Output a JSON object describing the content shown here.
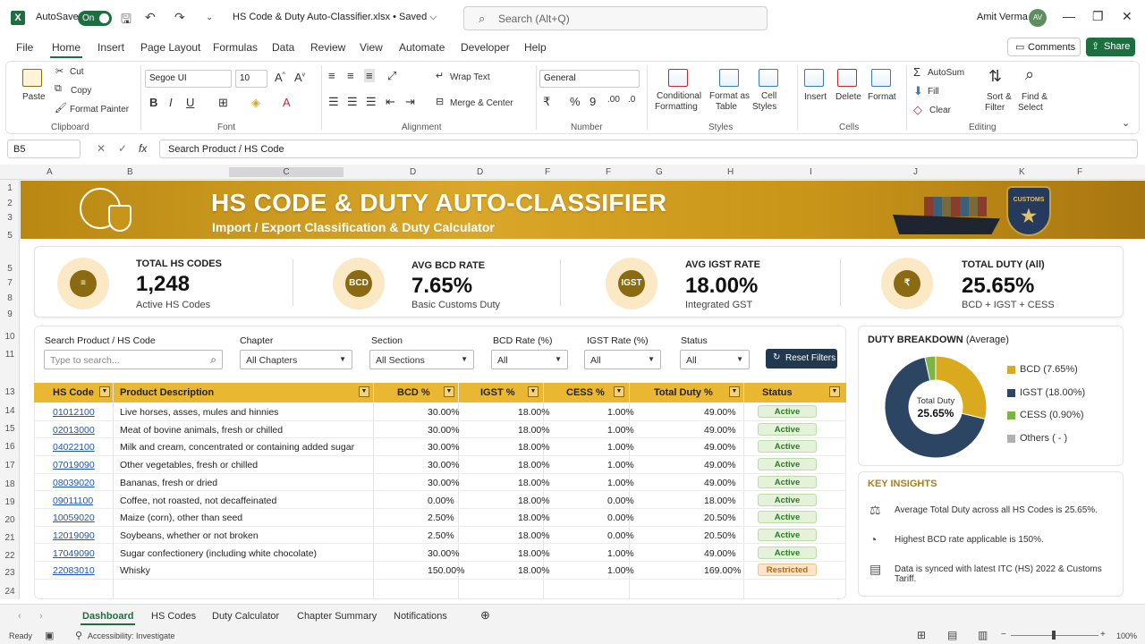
{
  "titlebar": {
    "autosave_label": "AutoSave",
    "toggle_label": "On",
    "filename": "HS Code & Duty Auto-Classifier.xlsx • Saved ⌵",
    "search_placeholder": "Search (Alt+Q)",
    "username": "Amit Verma",
    "avatar_initials": "AV"
  },
  "menu": {
    "tabs": [
      "File",
      "Home",
      "Insert",
      "Page Layout",
      "Formulas",
      "Data",
      "Review",
      "View",
      "Automate",
      "Developer",
      "Help"
    ],
    "comments": "Comments",
    "share": "Share"
  },
  "ribbon": {
    "clipboard": {
      "paste": "Paste",
      "cut": "Cut",
      "copy": "Copy",
      "format_painter": "Format Painter",
      "group": "Clipboard"
    },
    "font": {
      "name": "Segoe UI",
      "size": "10",
      "group": "Font"
    },
    "alignment": {
      "wrap": "Wrap Text",
      "merge": "Merge & Center",
      "group": "Alignment"
    },
    "number": {
      "format": "General",
      "group": "Number"
    },
    "styles": {
      "cond": "Conditional",
      "cond2": "Formatting",
      "fmt_table": "Format as",
      "fmt_table2": "Table",
      "cell_styles": "Cell",
      "cell_styles2": "Styles",
      "group": "Styles"
    },
    "cells": {
      "insert": "Insert",
      "delete": "Delete",
      "format": "Format",
      "group": "Cells"
    },
    "editing": {
      "autosum": "AutoSum",
      "fill": "Fill",
      "clear": "Clear",
      "sort": "Sort &",
      "sort2": "Filter",
      "find": "Find &",
      "find2": "Select",
      "group": "Editing"
    }
  },
  "formula_bar": {
    "name_box": "B5",
    "fx": "fx",
    "formula": "Search Product / HS Code"
  },
  "columns": [
    "A",
    "B",
    "C",
    "D",
    "D",
    "F",
    "F",
    "G",
    "H",
    "I",
    "J",
    "K",
    "F"
  ],
  "rows": [
    "1",
    "2",
    "3",
    "5",
    "5",
    "7",
    "8",
    "9",
    "10",
    "11",
    "13",
    "14",
    "15",
    "16",
    "17",
    "18",
    "19",
    "20",
    "21",
    "22",
    "23",
    "24"
  ],
  "banner": {
    "title": "HS CODE & DUTY AUTO-CLASSIFIER",
    "subtitle": "Import / Export Classification & Duty Calculator",
    "badge": "CUSTOMS"
  },
  "kpis": [
    {
      "label": "TOTAL HS CODES",
      "value": "1,248",
      "sub": "Active HS Codes",
      "icon": "stack-icon",
      "icon_text": "≡"
    },
    {
      "label": "AVG BCD RATE",
      "value": "7.65%",
      "sub": "Basic Customs Duty",
      "icon": "bcd-icon",
      "icon_text": "BCD"
    },
    {
      "label": "AVG IGST RATE",
      "value": "18.00%",
      "sub": "Integrated GST",
      "icon": "igst-icon",
      "icon_text": "IGST"
    },
    {
      "label": "TOTAL DUTY (All)",
      "value": "25.65%",
      "sub": "BCD + IGST + CESS",
      "icon": "piggy-bank-icon",
      "icon_text": "₹"
    }
  ],
  "filters": {
    "search": {
      "label": "Search Product / HS Code",
      "placeholder": "Type to search..."
    },
    "chapter": {
      "label": "Chapter",
      "value": "All Chapters"
    },
    "section": {
      "label": "Section",
      "value": "All Sections"
    },
    "bcd": {
      "label": "BCD Rate (%)",
      "value": "All"
    },
    "igst": {
      "label": "IGST Rate (%)",
      "value": "All"
    },
    "status": {
      "label": "Status",
      "value": "All"
    },
    "reset": "Reset Filters"
  },
  "table": {
    "headers": [
      "HS Code",
      "Product Description",
      "BCD %",
      "IGST %",
      "CESS %",
      "Total Duty %",
      "Status"
    ],
    "rows": [
      [
        "01012100",
        "Live horses, asses, mules and hinnies",
        "30.00%",
        "18.00%",
        "1.00%",
        "49.00%",
        "Active"
      ],
      [
        "02013000",
        "Meat of bovine animals, fresh or chilled",
        "30.00%",
        "18.00%",
        "1.00%",
        "49.00%",
        "Active"
      ],
      [
        "04022100",
        "Milk and cream, concentrated or containing added sugar",
        "30.00%",
        "18.00%",
        "1.00%",
        "49.00%",
        "Active"
      ],
      [
        "07019090",
        "Other vegetables, fresh or chilled",
        "30.00%",
        "18.00%",
        "1.00%",
        "49.00%",
        "Active"
      ],
      [
        "08039020",
        "Bananas, fresh or dried",
        "30.00%",
        "18.00%",
        "1.00%",
        "49.00%",
        "Active"
      ],
      [
        "09011100",
        "Coffee, not roasted, not decaffeinated",
        "0.00%",
        "18.00%",
        "0.00%",
        "18.00%",
        "Active"
      ],
      [
        "10059020",
        "Maize (corn), other than seed",
        "2.50%",
        "18.00%",
        "0.00%",
        "20.50%",
        "Active"
      ],
      [
        "12019090",
        "Soybeans, whether or not broken",
        "2.50%",
        "18.00%",
        "0.00%",
        "20.50%",
        "Active"
      ],
      [
        "17049090",
        "Sugar confectionery (including white chocolate)",
        "30.00%",
        "18.00%",
        "1.00%",
        "49.00%",
        "Active"
      ],
      [
        "22083010",
        "Whisky",
        "150.00%",
        "18.00%",
        "1.00%",
        "169.00%",
        "Restricted"
      ]
    ]
  },
  "donut": {
    "title": "DUTY BREAKDOWN",
    "title_suffix": "(Average)",
    "center_label": "Total Duty",
    "center_value": "25.65%",
    "legend": [
      {
        "label": "BCD (7.65%)",
        "color": "#d9a91e"
      },
      {
        "label": "IGST (18.00%)",
        "color": "#2b4563"
      },
      {
        "label": "CESS (0.90%)",
        "color": "#7cb342"
      },
      {
        "label": "Others ( - )",
        "color": "#b0b0b0"
      }
    ]
  },
  "insights": {
    "title": "KEY INSIGHTS",
    "items": [
      {
        "icon": "scale-icon",
        "glyph": "⚖",
        "text": "Average Total Duty across all HS Codes is 25.65%."
      },
      {
        "icon": "pie-icon",
        "glyph": "◔",
        "text": "Highest BCD rate applicable is 150%."
      },
      {
        "icon": "document-icon",
        "glyph": "▤",
        "text": "Data is synced with latest ITC (HS) 2022 & Customs Tariff."
      }
    ]
  },
  "sheets": [
    "Dashboard",
    "HS Codes",
    "Duty Calculator",
    "Chapter Summary",
    "Notifications"
  ],
  "status": {
    "ready": "Ready",
    "accessibility": "Accessibility: Investigate",
    "zoom": "100%"
  }
}
